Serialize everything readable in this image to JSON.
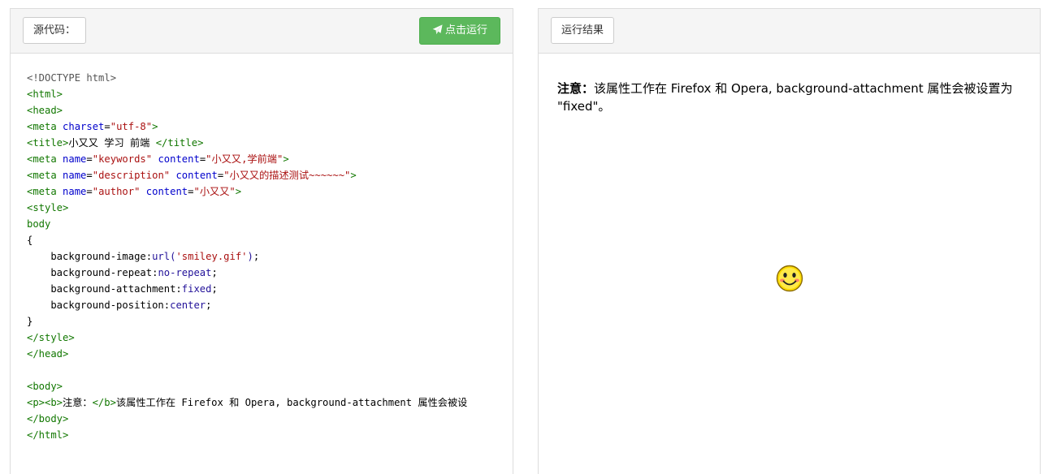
{
  "source_panel": {
    "tab_label": "源代码：",
    "run_button_label": "点击运行",
    "run_button_icon": "paper-plane-icon",
    "accent_color": "#5cb85c",
    "code_lines": [
      [
        {
          "t": "meta",
          "s": "<!DOCTYPE html>"
        }
      ],
      [
        {
          "t": "tag",
          "s": "<html>"
        }
      ],
      [
        {
          "t": "tag",
          "s": "<head>"
        }
      ],
      [
        {
          "t": "tag",
          "s": "<meta "
        },
        {
          "t": "attr",
          "s": "charset"
        },
        {
          "t": "plain",
          "s": "="
        },
        {
          "t": "str",
          "s": "\"utf-8\""
        },
        {
          "t": "tag",
          "s": ">"
        }
      ],
      [
        {
          "t": "tag",
          "s": "<title>"
        },
        {
          "t": "text",
          "s": "小又又 学习 前端 "
        },
        {
          "t": "tag",
          "s": "</title>"
        }
      ],
      [
        {
          "t": "tag",
          "s": "<meta "
        },
        {
          "t": "attr",
          "s": "name"
        },
        {
          "t": "plain",
          "s": "="
        },
        {
          "t": "str",
          "s": "\"keywords\""
        },
        {
          "t": "plain",
          "s": " "
        },
        {
          "t": "attr",
          "s": "content"
        },
        {
          "t": "plain",
          "s": "="
        },
        {
          "t": "str",
          "s": "\"小又又,学前端\""
        },
        {
          "t": "tag",
          "s": ">"
        }
      ],
      [
        {
          "t": "tag",
          "s": "<meta "
        },
        {
          "t": "attr",
          "s": "name"
        },
        {
          "t": "plain",
          "s": "="
        },
        {
          "t": "str",
          "s": "\"description\""
        },
        {
          "t": "plain",
          "s": " "
        },
        {
          "t": "attr",
          "s": "content"
        },
        {
          "t": "plain",
          "s": "="
        },
        {
          "t": "str",
          "s": "\"小又又的描述测试~~~~~~\""
        },
        {
          "t": "tag",
          "s": ">"
        }
      ],
      [
        {
          "t": "tag",
          "s": "<meta "
        },
        {
          "t": "attr",
          "s": "name"
        },
        {
          "t": "plain",
          "s": "="
        },
        {
          "t": "str",
          "s": "\"author\""
        },
        {
          "t": "plain",
          "s": " "
        },
        {
          "t": "attr",
          "s": "content"
        },
        {
          "t": "plain",
          "s": "="
        },
        {
          "t": "str",
          "s": "\"小又又\""
        },
        {
          "t": "tag",
          "s": ">"
        }
      ],
      [
        {
          "t": "tag",
          "s": "<style>"
        }
      ],
      [
        {
          "t": "tag",
          "s": "body"
        }
      ],
      [
        {
          "t": "plain",
          "s": "{"
        }
      ],
      [
        {
          "t": "prop",
          "s": "    background-image:"
        },
        {
          "t": "val",
          "s": "url("
        },
        {
          "t": "str",
          "s": "'smiley.gif'"
        },
        {
          "t": "val",
          "s": ")"
        },
        {
          "t": "plain",
          "s": ";"
        }
      ],
      [
        {
          "t": "prop",
          "s": "    background-repeat:"
        },
        {
          "t": "val",
          "s": "no-repeat"
        },
        {
          "t": "plain",
          "s": ";"
        }
      ],
      [
        {
          "t": "prop",
          "s": "    background-attachment:"
        },
        {
          "t": "val",
          "s": "fixed"
        },
        {
          "t": "plain",
          "s": ";"
        }
      ],
      [
        {
          "t": "prop",
          "s": "    background-position:"
        },
        {
          "t": "val",
          "s": "center"
        },
        {
          "t": "plain",
          "s": ";"
        }
      ],
      [
        {
          "t": "plain",
          "s": "}"
        }
      ],
      [
        {
          "t": "tag",
          "s": "</style>"
        }
      ],
      [
        {
          "t": "tag",
          "s": "</head>"
        }
      ],
      [
        {
          "t": "plain",
          "s": ""
        }
      ],
      [
        {
          "t": "tag",
          "s": "<body>"
        }
      ],
      [
        {
          "t": "tag",
          "s": "<p><b>"
        },
        {
          "t": "text",
          "s": "注意："
        },
        {
          "t": "tag",
          "s": "</b>"
        },
        {
          "t": "text",
          "s": "该属性工作在 Firefox 和 Opera, background-attachment 属性会被设"
        }
      ],
      [
        {
          "t": "tag",
          "s": "</body>"
        }
      ],
      [
        {
          "t": "tag",
          "s": "</html>"
        }
      ]
    ]
  },
  "result_panel": {
    "tab_label": "运行结果",
    "note_label": "注意：",
    "note_text": "该属性工作在 Firefox 和 Opera, background-attachment 属性会被设置为 \"fixed\"。",
    "background_image_icon": "smiley-face-icon"
  }
}
